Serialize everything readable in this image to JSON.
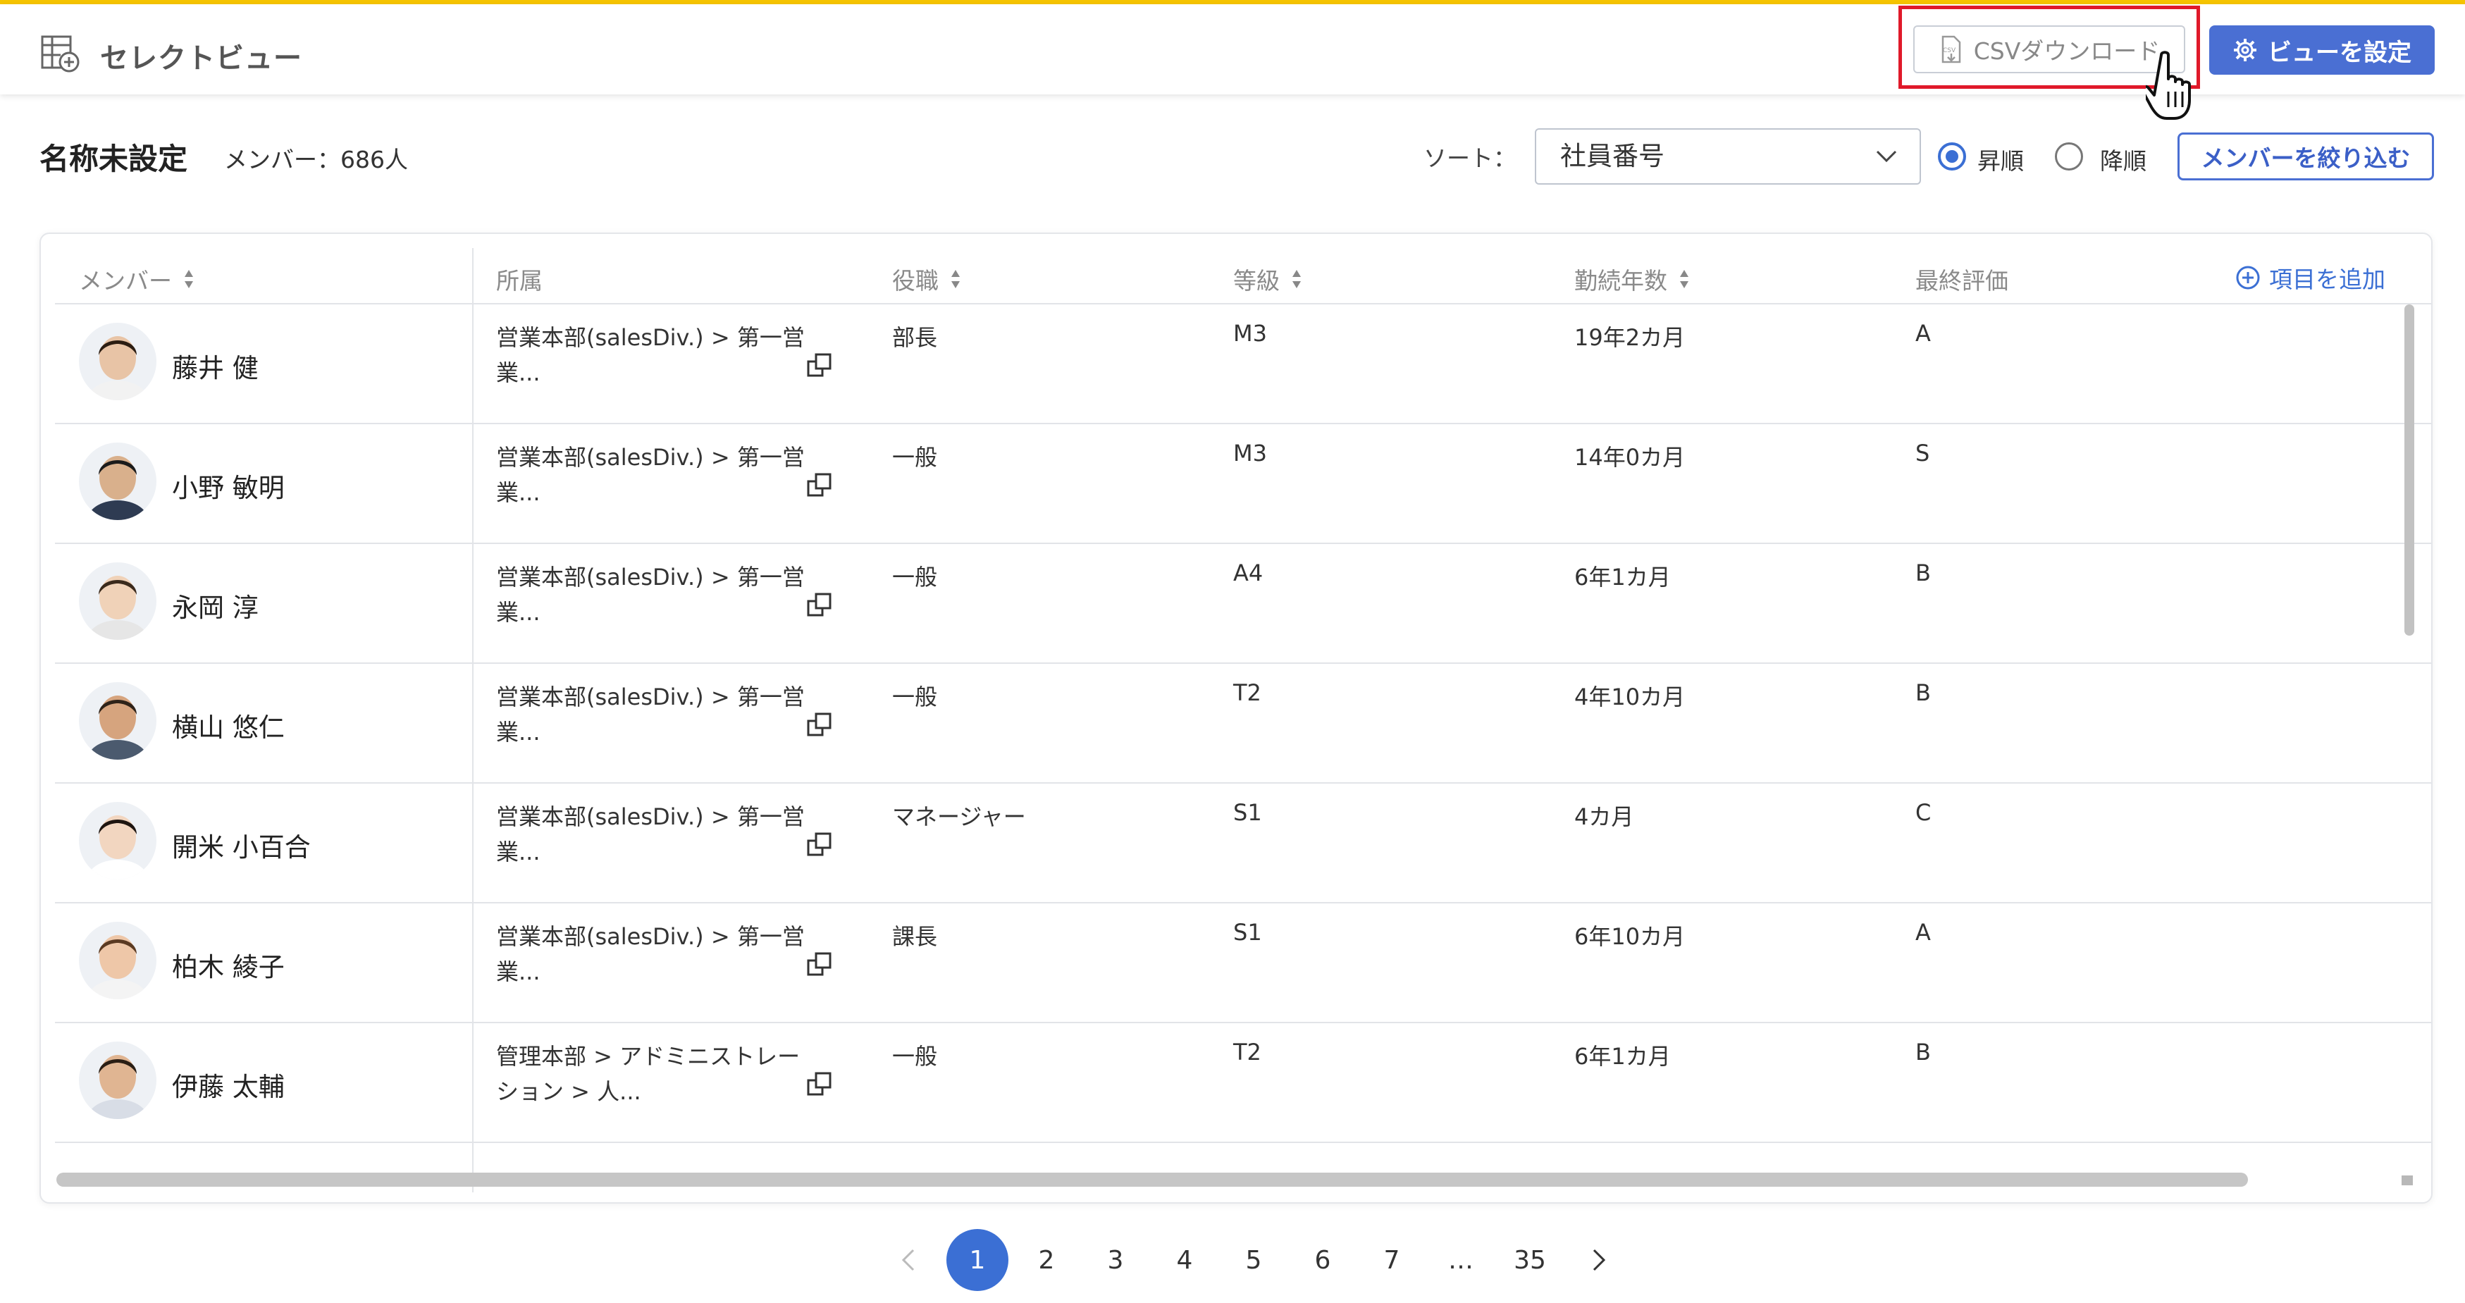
{
  "colors": {
    "accent": "#3b6fd4",
    "highlight": "#e0192a",
    "top_stripe": "#f6c400"
  },
  "header": {
    "title": "セレクトビュー",
    "title_icon": "table-add-icon",
    "csv_label": "CSVダウンロード",
    "csv_icon": "csv-download-icon",
    "view_label": "ビューを設定",
    "view_icon": "gear-icon"
  },
  "toolbar": {
    "name": "名称未設定",
    "member_count": "メンバー：686人",
    "sort_label": "ソート：",
    "sort_value": "社員番号",
    "asc_label": "昇順",
    "desc_label": "降順",
    "order": "asc",
    "filter_label": "メンバーを絞り込む"
  },
  "table": {
    "columns": [
      "メンバー",
      "所属",
      "役職",
      "等級",
      "勤続年数",
      "最終評価"
    ],
    "add_column": "項目を追加",
    "rows": [
      {
        "name": "藤井 健",
        "dept": "営業本部(salesDiv.) > 第一営業...",
        "position": "部長",
        "grade": "M3",
        "tenure": "19年2カ月",
        "rating": "A"
      },
      {
        "name": "小野 敏明",
        "dept": "営業本部(salesDiv.) > 第一営業...",
        "position": "一般",
        "grade": "M3",
        "tenure": "14年0カ月",
        "rating": "S"
      },
      {
        "name": "永岡 淳",
        "dept": "営業本部(salesDiv.) > 第一営業...",
        "position": "一般",
        "grade": "A4",
        "tenure": "6年1カ月",
        "rating": "B"
      },
      {
        "name": "横山 悠仁",
        "dept": "営業本部(salesDiv.) > 第一営業...",
        "position": "一般",
        "grade": "T2",
        "tenure": "4年10カ月",
        "rating": "B"
      },
      {
        "name": "開米 小百合",
        "dept": "営業本部(salesDiv.) > 第一営業...",
        "position": "マネージャー",
        "grade": "S1",
        "tenure": "4カ月",
        "rating": "C"
      },
      {
        "name": "柏木 綾子",
        "dept": "営業本部(salesDiv.) > 第一営業...",
        "position": "課長",
        "grade": "S1",
        "tenure": "6年10カ月",
        "rating": "A"
      },
      {
        "name": "伊藤 太輔",
        "dept": "管理本部 > アドミニストレーション > 人...",
        "position": "一般",
        "grade": "T2",
        "tenure": "6年1カ月",
        "rating": "B"
      }
    ]
  },
  "pagination": {
    "pages": [
      "1",
      "2",
      "3",
      "4",
      "5",
      "6",
      "7",
      "…",
      "35"
    ],
    "current": "1"
  }
}
